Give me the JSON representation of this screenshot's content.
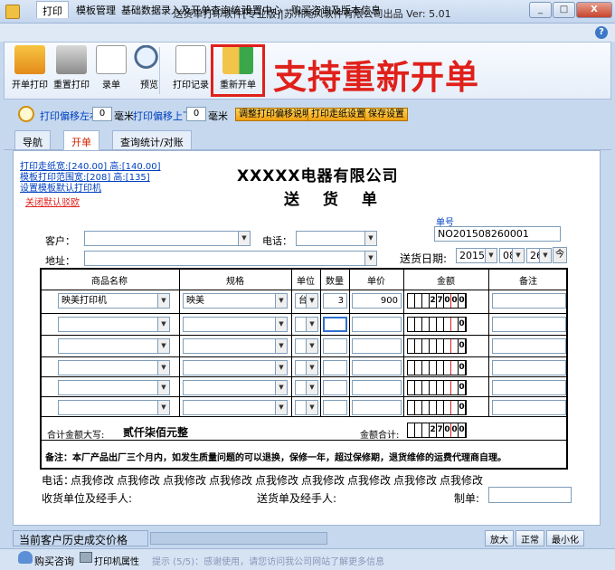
{
  "window": {
    "title": "送货单打印软件[专业版]|苏州飏风软件有限公司出品   Ver: 5.01",
    "minimize": "_",
    "maximize": "□",
    "close": "X"
  },
  "menu": {
    "items": [
      "打印",
      "模板管理",
      "基础数据录入及开单查询统计",
      "设置中心",
      "购买咨询及版本信息"
    ],
    "help": "?"
  },
  "toolbar": {
    "buttons": [
      "开单打印",
      "重置打印",
      "录单",
      "预览",
      "打印记录",
      "重新开单"
    ],
    "promo": "支持重新开单"
  },
  "print_offset": {
    "lr_label": "打印偏移左右",
    "lr_value": "0",
    "unit1": "毫米",
    "ud_label": "打印偏移上下",
    "ud_value": "0",
    "unit2": "毫米",
    "btn_explain": "调整打印偏移说明",
    "btn_paper": "打印走纸设置",
    "btn_save": "保存设置"
  },
  "tabs": [
    "导航",
    "开单",
    "查询统计/对账"
  ],
  "side": {
    "paper_size": "打印走纸宽:[240.00] 高:[140.00]",
    "template_range": "模板打印范围宽:[208] 高:[135]",
    "default_printer": "设置模板默认打印机",
    "close_tip": "关闭默认驳欧"
  },
  "doc": {
    "company": "XXXXX电器有限公司",
    "title": "送  货  单",
    "no_label": "单号",
    "no_value": "NO201508260001",
    "customer_label": "客户：",
    "phone_label": "电话：",
    "address_label": "地址：",
    "date_label": "送货日期:",
    "year": "2015",
    "month": "08",
    "day": "26",
    "today_btn": "今"
  },
  "table": {
    "headers": [
      "商品名称",
      "规格",
      "单位",
      "数量",
      "单价",
      "金额",
      "备注"
    ],
    "rows": [
      {
        "name": "映美打印机",
        "spec": "映美",
        "unit": "台",
        "qty": "3",
        "price": "900",
        "digits": [
          "",
          "",
          "",
          "2",
          "7",
          "0",
          "0",
          "0"
        ]
      },
      {
        "name": "",
        "spec": "",
        "unit": "",
        "qty": "",
        "price": "",
        "digits": [
          "",
          "",
          "",
          "",
          "",
          "",
          "",
          "0"
        ]
      },
      {
        "name": "",
        "spec": "",
        "unit": "",
        "qty": "",
        "price": "",
        "digits": [
          "",
          "",
          "",
          "",
          "",
          "",
          "",
          "0"
        ]
      },
      {
        "name": "",
        "spec": "",
        "unit": "",
        "qty": "",
        "price": "",
        "digits": [
          "",
          "",
          "",
          "",
          "",
          "",
          "",
          "0"
        ]
      },
      {
        "name": "",
        "spec": "",
        "unit": "",
        "qty": "",
        "price": "",
        "digits": [
          "",
          "",
          "",
          "",
          "",
          "",
          "",
          "0"
        ]
      },
      {
        "name": "",
        "spec": "",
        "unit": "",
        "qty": "",
        "price": "",
        "digits": [
          "",
          "",
          "",
          "",
          "",
          "",
          "",
          "0"
        ]
      }
    ],
    "total_caps_label": "合计金额大写:",
    "total_caps_value": "贰仟柒佰元整",
    "total_label": "金额合计:",
    "total_digits": [
      "",
      "",
      "",
      "2",
      "7",
      "0",
      "0",
      "0"
    ],
    "note": "备注：本厂产品出厂三个月内，如发生质量问题的可以退换，保修一年，超过保修期，退货维修的运费代理商自理。"
  },
  "footer": {
    "phone_label": "电话：",
    "phones": [
      "点我修改",
      "点我修改",
      "点我修改",
      "点我修改",
      "点我修改",
      "点我修改",
      "点我修改",
      "点我修改",
      "点我修改"
    ],
    "receiver_label": "收货单位及经手人:",
    "sender_label": "送货单及经手人:",
    "maker_label": "制单:"
  },
  "bottom": {
    "history": "当前客户历史成交价格",
    "zoom_in": "放大",
    "normal": "正常",
    "minimize": "最小化"
  },
  "status": {
    "buy": "购买咨询",
    "printer": "打印机属性",
    "tip": "提示 (5/5)：感谢使用，请您访问我公司网站了解更多信息"
  }
}
